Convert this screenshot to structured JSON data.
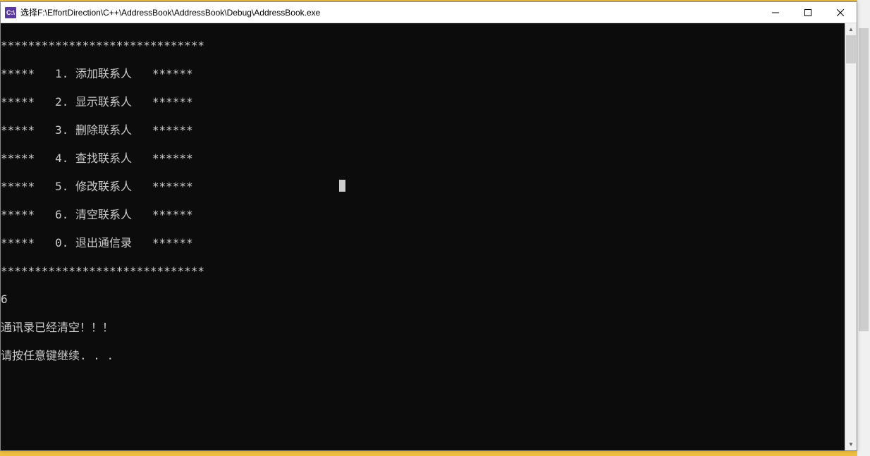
{
  "titlebar": {
    "icon_text": "C:\\",
    "title": "选择F:\\EffortDirection\\C++\\AddressBook\\AddressBook\\Debug\\AddressBook.exe"
  },
  "console": {
    "border_top": "******************************",
    "menu": [
      {
        "left": "*****",
        "item": "1. 添加联系人",
        "right": "******"
      },
      {
        "left": "*****",
        "item": "2. 显示联系人",
        "right": "******"
      },
      {
        "left": "*****",
        "item": "3. 删除联系人",
        "right": "******"
      },
      {
        "left": "*****",
        "item": "4. 查找联系人",
        "right": "******"
      },
      {
        "left": "*****",
        "item": "5. 修改联系人",
        "right": "******"
      },
      {
        "left": "*****",
        "item": "6. 清空联系人",
        "right": "******"
      },
      {
        "left": "*****",
        "item": "0. 退出通信录",
        "right": "******"
      }
    ],
    "border_bottom": "******************************",
    "input": "6",
    "msg1": "通讯录已经清空！！！",
    "msg2": "请按任意键继续. . ."
  }
}
